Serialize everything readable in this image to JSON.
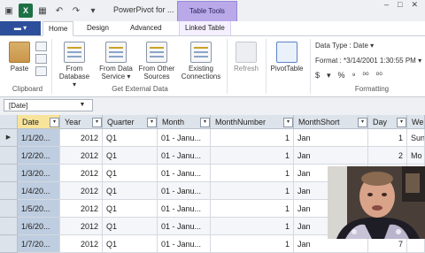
{
  "titlebar": {
    "doc_title": "PowerPivot for ...",
    "contextual_tab": "Table Tools",
    "controls": [
      "–",
      "□",
      "✕"
    ]
  },
  "tabs": {
    "file_label": "▬ ▾",
    "items": [
      "Home",
      "Design",
      "Advanced",
      "Linked Table"
    ]
  },
  "ribbon": {
    "clipboard": {
      "paste": "Paste",
      "group": "Clipboard"
    },
    "external": {
      "from_database": [
        "From",
        "Database ▾"
      ],
      "from_data_service": [
        "From Data",
        "Service ▾"
      ],
      "from_other_sources": [
        "From Other",
        "Sources"
      ],
      "existing_connections": [
        "Existing",
        "Connections"
      ],
      "group": "Get External Data"
    },
    "refresh": "Refresh",
    "pivottable": "PivotTable",
    "formatting": {
      "data_type": "Data Type : Date ▾",
      "format": "Format : *3/14/2001 1:30:55 PM ▾",
      "symbols": [
        "$",
        "▾",
        "%",
        "⁹",
        "⁰⁰",
        "⁰⁰"
      ],
      "group": "Formatting"
    }
  },
  "formula": {
    "namebox": "[Date]",
    "arrow": "▼"
  },
  "grid": {
    "columns": [
      "Date",
      "Year",
      "Quarter",
      "Month",
      "MonthNumber",
      "MonthShort",
      "Day",
      "We"
    ],
    "filter_glyph": "▾",
    "rows": [
      [
        "1/1/20...",
        "2012",
        "Q1",
        "01 - Janu...",
        "1",
        "Jan",
        "1",
        "Sun"
      ],
      [
        "1/2/20...",
        "2012",
        "Q1",
        "01 - Janu...",
        "1",
        "Jan",
        "2",
        "Mo"
      ],
      [
        "1/3/20...",
        "2012",
        "Q1",
        "01 - Janu...",
        "1",
        "Jan",
        "3",
        "Tue"
      ],
      [
        "1/4/20...",
        "2012",
        "Q1",
        "01 - Janu...",
        "1",
        "Jan",
        "4",
        ""
      ],
      [
        "1/5/20...",
        "2012",
        "Q1",
        "01 - Janu...",
        "1",
        "Jan",
        "5",
        ""
      ],
      [
        "1/6/20...",
        "2012",
        "Q1",
        "01 - Janu...",
        "1",
        "Jan",
        "6",
        ""
      ],
      [
        "1/7/20...",
        "2012",
        "Q1",
        "01 - Janu...",
        "1",
        "Jan",
        "7",
        ""
      ]
    ],
    "current_row_marker": "▶"
  }
}
